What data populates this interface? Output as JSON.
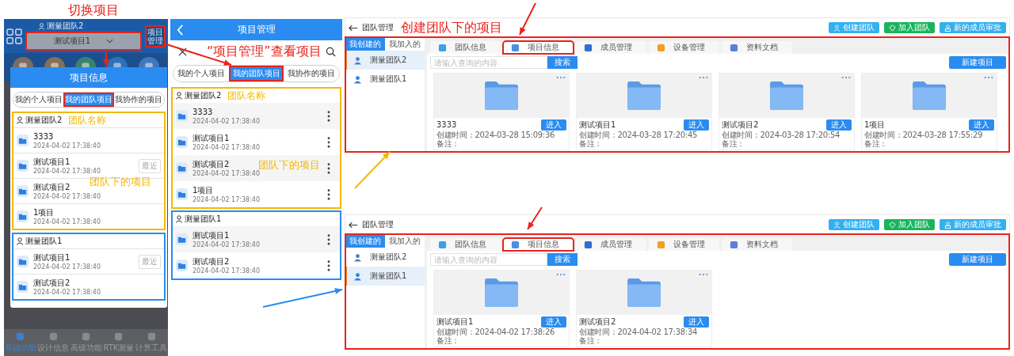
{
  "phone_home": {
    "annotation": "切换项目",
    "team_label": "测量团队2",
    "project_select": "测试项目1",
    "manage_button": "项目管理",
    "dialog": {
      "title": "项目信息",
      "tabs": [
        {
          "label": "我的个人项目",
          "selected": false
        },
        {
          "label": "我的团队项目",
          "selected": true
        },
        {
          "label": "我协作的项目",
          "selected": false
        }
      ],
      "groups": [
        {
          "team": "测量团队2",
          "color": "#f5b800",
          "team_note": "团队名称",
          "projects_note": "团队下的项目",
          "projects": [
            {
              "name": "3333",
              "time": "2024-04-02 17:38:40"
            },
            {
              "name": "测试项目1",
              "time": "2024-04-02 17:38:40",
              "tag": "最近"
            },
            {
              "name": "测试项目2",
              "time": "2024-04-02 17:38:40"
            },
            {
              "name": "1项目",
              "time": "2024-04-02 17:38:40"
            }
          ]
        },
        {
          "team": "测量团队1",
          "color": "#2a8cf0",
          "projects": [
            {
              "name": "测试项目1",
              "time": "2024-04-02 17:38:40",
              "tag": "最近"
            },
            {
              "name": "测试项目2",
              "time": "2024-04-02 17:38:40"
            }
          ]
        }
      ]
    },
    "nav": [
      {
        "label": "基础功能",
        "selected": true
      },
      {
        "label": "设计信息",
        "selected": false
      },
      {
        "label": "高级功能",
        "selected": false
      },
      {
        "label": "RTK测量",
        "selected": false
      },
      {
        "label": "计算工具",
        "selected": false
      }
    ]
  },
  "phone_manager": {
    "title": "项目管理",
    "annotation": "“项目管理”查看项目",
    "tabs": [
      {
        "label": "我的个人项目",
        "selected": false
      },
      {
        "label": "我的团队项目",
        "selected": true
      },
      {
        "label": "我协作的项目",
        "selected": false
      }
    ],
    "groups": [
      {
        "team": "测量团队2",
        "color": "#f5b800",
        "team_note": "团队名称",
        "projects_note": "团队下的项目",
        "projects": [
          {
            "name": "3333",
            "time": "2024-04-02 17:38:40"
          },
          {
            "name": "测试项目1",
            "time": "2024-04-02 17:38:40"
          },
          {
            "name": "测试项目2",
            "time": "2024-04-02 17:38:40"
          },
          {
            "name": "1项目",
            "time": "2024-04-02 17:38:40"
          }
        ]
      },
      {
        "team": "测量团队1",
        "color": "#2a8cf0",
        "projects": [
          {
            "name": "测试项目1",
            "time": "2024-04-02 17:38:40"
          },
          {
            "name": "测试项目2",
            "time": "2024-04-02 17:38:40"
          }
        ]
      }
    ]
  },
  "web_top": {
    "title": "团队管理",
    "annotation": "创建团队下的项目",
    "actions": [
      {
        "label": "创建团队",
        "kind": "create"
      },
      {
        "label": "加入团队",
        "kind": "join"
      },
      {
        "label": "新的成员审批",
        "kind": "approve"
      }
    ],
    "side_tabs": [
      {
        "label": "我创建的",
        "selected": true
      },
      {
        "label": "我加入的",
        "selected": false
      }
    ],
    "teams": [
      {
        "name": "测量团队2",
        "selected": true
      },
      {
        "name": "测量团队1",
        "selected": false
      }
    ],
    "tabs": [
      {
        "label": "团队信息",
        "kind": "info",
        "selected": false
      },
      {
        "label": "项目信息",
        "kind": "project",
        "selected": true
      },
      {
        "label": "成员管理",
        "kind": "member",
        "selected": false
      },
      {
        "label": "设备管理",
        "kind": "device",
        "selected": false
      },
      {
        "label": "资料文档",
        "kind": "docs",
        "selected": false
      }
    ],
    "placeholder": "请输入查询的内容",
    "search_button": "搜索",
    "new_button": "新建项目",
    "projects": [
      {
        "name": "3333",
        "created": "创建时间：2024-03-28 15:09:36",
        "note": "备注：",
        "button": "进入"
      },
      {
        "name": "测试项目1",
        "created": "创建时间：2024-03-28 17:20:45",
        "note": "备注：",
        "button": "进入"
      },
      {
        "name": "测试项目2",
        "created": "创建时间：2024-03-28 17:20:54",
        "note": "备注：",
        "button": "进入"
      },
      {
        "name": "1项目",
        "created": "创建时间：2024-03-28 17:55:29",
        "note": "备注：",
        "button": "进入"
      }
    ]
  },
  "web_bottom": {
    "title": "团队管理",
    "actions": [
      {
        "label": "创建团队",
        "kind": "create"
      },
      {
        "label": "加入团队",
        "kind": "join"
      },
      {
        "label": "新的成员审批",
        "kind": "approve"
      }
    ],
    "side_tabs": [
      {
        "label": "我创建的",
        "selected": true
      },
      {
        "label": "我加入的",
        "selected": false
      }
    ],
    "teams": [
      {
        "name": "测量团队2",
        "selected": false
      },
      {
        "name": "测量团队1",
        "selected": true
      }
    ],
    "tabs": [
      {
        "label": "团队信息",
        "kind": "info",
        "selected": false
      },
      {
        "label": "项目信息",
        "kind": "project",
        "selected": true
      },
      {
        "label": "成员管理",
        "kind": "member",
        "selected": false
      },
      {
        "label": "设备管理",
        "kind": "device",
        "selected": false
      },
      {
        "label": "资料文档",
        "kind": "docs",
        "selected": false
      }
    ],
    "placeholder": "请输入查询的内容",
    "search_button": "搜索",
    "new_button": "新建项目",
    "projects": [
      {
        "name": "测试项目1",
        "created": "创建时间：2024-04-02 17:38:26",
        "note": "备注：",
        "button": "进入"
      },
      {
        "name": "测试项目2",
        "created": "创建时间：2024-04-02 17:38:34",
        "note": "备注：",
        "button": "进入"
      }
    ]
  }
}
